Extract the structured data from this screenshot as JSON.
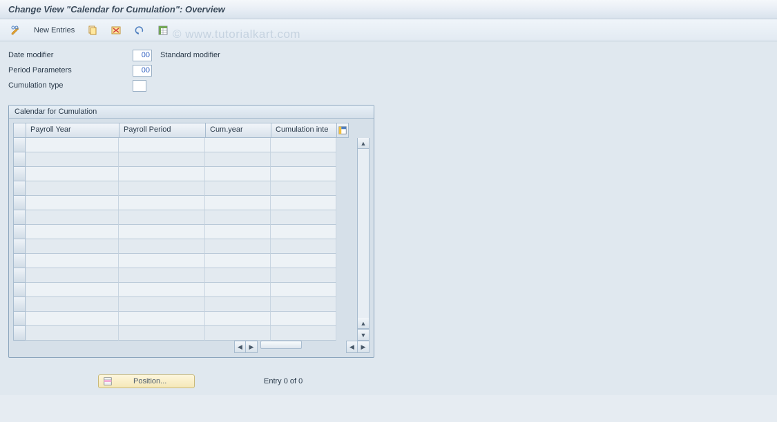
{
  "title": "Change View \"Calendar for Cumulation\": Overview",
  "watermark": "© www.tutorialkart.com",
  "toolbar": {
    "new_entries_label": "New Entries"
  },
  "header": {
    "date_modifier": {
      "label": "Date modifier",
      "value": "00",
      "desc": "Standard modifier"
    },
    "period_params": {
      "label": "Period Parameters",
      "value": "00"
    },
    "cumulation_type": {
      "label": "Cumulation type",
      "value": ""
    }
  },
  "panel": {
    "title": "Calendar for Cumulation",
    "columns": {
      "payroll_year": "Payroll Year",
      "payroll_period": "Payroll Period",
      "cum_year": "Cum.year",
      "cum_inte": "Cumulation inte"
    }
  },
  "footer": {
    "position_label": "Position...",
    "entry_text": "Entry 0 of 0"
  }
}
